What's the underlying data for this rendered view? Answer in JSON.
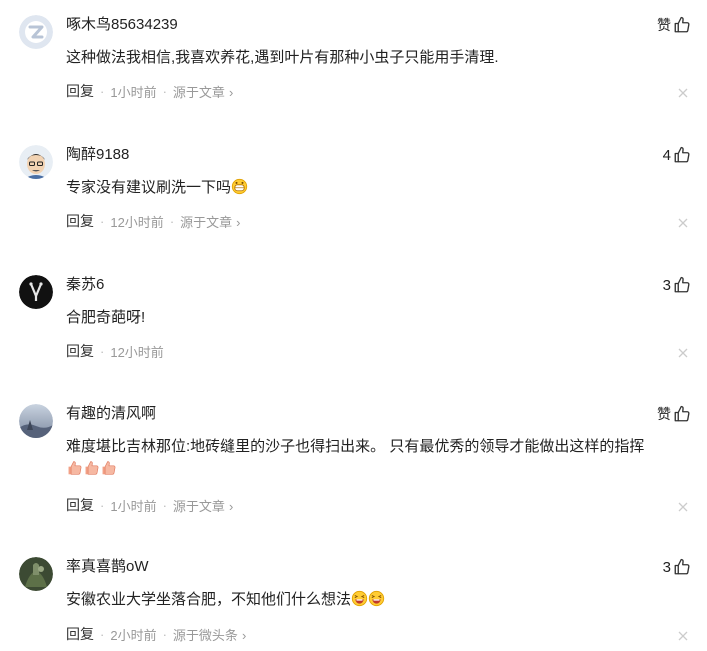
{
  "comments": [
    {
      "username": "啄木鸟85634239",
      "like_label": "赞",
      "text": "这种做法我相信,我喜欢养花,遇到叶片有那种小虫子只能用手清理.",
      "reply": "回复",
      "time": "1小时前",
      "source": "源于文章"
    },
    {
      "username": "陶醉9188",
      "like_count": "4",
      "text": "专家没有建议刷洗一下吗",
      "reply": "回复",
      "time": "12小时前",
      "source": "源于文章",
      "emoji": "grinning-face-emoji"
    },
    {
      "username": "秦苏6",
      "like_count": "3",
      "text": "合肥奇葩呀!",
      "reply": "回复",
      "time": "12小时前"
    },
    {
      "username": "有趣的清风啊",
      "like_label": "赞",
      "text": "难度堪比吉林那位:地砖缝里的沙子也得扫出来。 只有最优秀的领导才能做出这样的指挥",
      "reply": "回复",
      "time": "1小时前",
      "source": "源于文章",
      "emoji": "thumbs-up-emoji"
    },
    {
      "username": "率真喜鹊oW",
      "like_count": "3",
      "text": "安徽农业大学坐落合肥，不知他们什么想法",
      "reply": "回复",
      "time": "2小时前",
      "source": "源于微头条",
      "emoji": "laughing-face-emoji"
    }
  ],
  "colors": {
    "text": "#222222",
    "meta": "#999999",
    "background": "#ffffff"
  }
}
